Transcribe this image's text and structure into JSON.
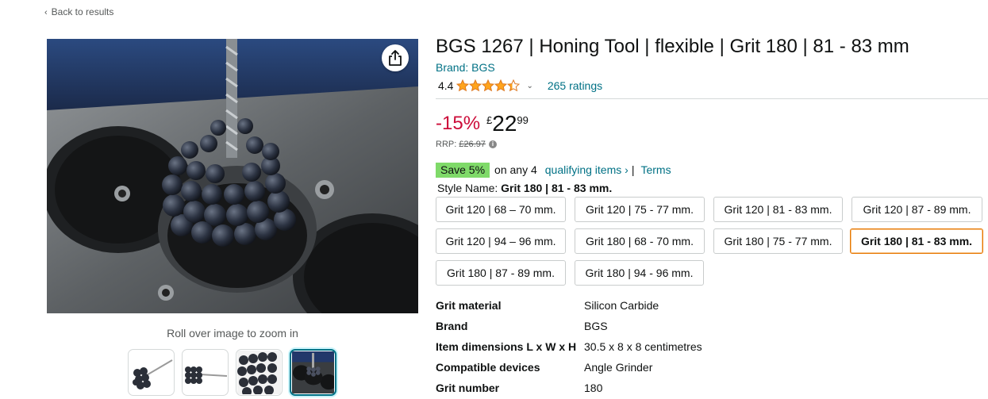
{
  "nav": {
    "back_label": "Back to results"
  },
  "gallery": {
    "zoom_hint": "Roll over image to zoom in",
    "thumbnail_count": 4,
    "active_thumbnail": 4
  },
  "product": {
    "title": "BGS 1267 | Honing Tool | flexible | Grit 180 | 81 - 83 mm",
    "brand": "Brand: BGS",
    "rating": "4.4",
    "rating_stars": 4.4,
    "ratings_count": "265 ratings"
  },
  "price": {
    "discount": "-15%",
    "currency": "£",
    "whole": "22",
    "fraction": "99",
    "rrp_label": "RRP:",
    "rrp_value": "£26.97"
  },
  "promo": {
    "badge": "Save 5%",
    "text": "on any 4",
    "link": "qualifying items ›",
    "separator": "|",
    "terms": "Terms"
  },
  "style": {
    "label": "Style Name:",
    "value": "Grit 180 | 81 - 83 mm.",
    "options": [
      "Grit 120 | 68 – 70 mm.",
      "Grit 120 | 75 - 77 mm.",
      "Grit 120 | 81 - 83 mm.",
      "Grit 120 | 87 - 89 mm.",
      "Grit 120 | 94 – 96 mm.",
      "Grit 180 | 68 - 70 mm.",
      "Grit 180 | 75 - 77 mm.",
      "Grit 180 | 81 - 83 mm.",
      "Grit 180 | 87 - 89 mm.",
      "Grit 180 | 94 - 96 mm."
    ],
    "selected_index": 7
  },
  "specs": [
    {
      "key": "Grit material",
      "value": "Silicon Carbide"
    },
    {
      "key": "Brand",
      "value": "BGS"
    },
    {
      "key": "Item dimensions L x W x H",
      "value": "30.5 x 8 x 8 centimetres"
    },
    {
      "key": "Compatible devices",
      "value": "Angle Grinder"
    },
    {
      "key": "Grit number",
      "value": "180"
    }
  ],
  "colors": {
    "link": "#007185",
    "discount": "#cc0c39",
    "star": "#ffa41c",
    "badge": "#7fda69",
    "selected_border": "#e77600"
  },
  "icons": {
    "share": "share-icon",
    "back": "chevron-left-icon",
    "star": "star-icon",
    "info": "info-icon"
  }
}
